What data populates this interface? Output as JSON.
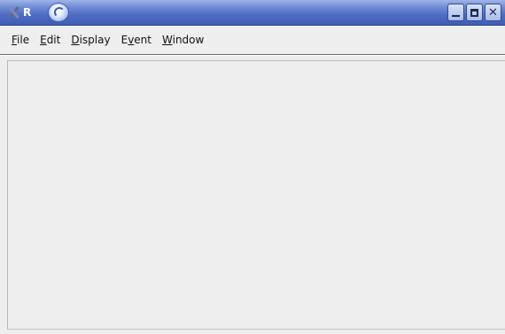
{
  "titlebar": {
    "logo_glyph": "R",
    "buttons": [
      "minimize",
      "maximize",
      "close"
    ]
  },
  "menu": {
    "items": [
      {
        "label_pre": "",
        "mnemonic": "F",
        "label_post": "ile"
      },
      {
        "label_pre": "",
        "mnemonic": "E",
        "label_post": "dit"
      },
      {
        "label_pre": "",
        "mnemonic": "D",
        "label_post": "isplay"
      },
      {
        "label_pre": "E",
        "mnemonic": "v",
        "label_post": "ent"
      },
      {
        "label_pre": "",
        "mnemonic": "W",
        "label_post": "indow"
      }
    ]
  },
  "close_glyph": "✕",
  "colors": {
    "titlebar": "#4f6cc4",
    "window_bg": "#eeeeee"
  }
}
